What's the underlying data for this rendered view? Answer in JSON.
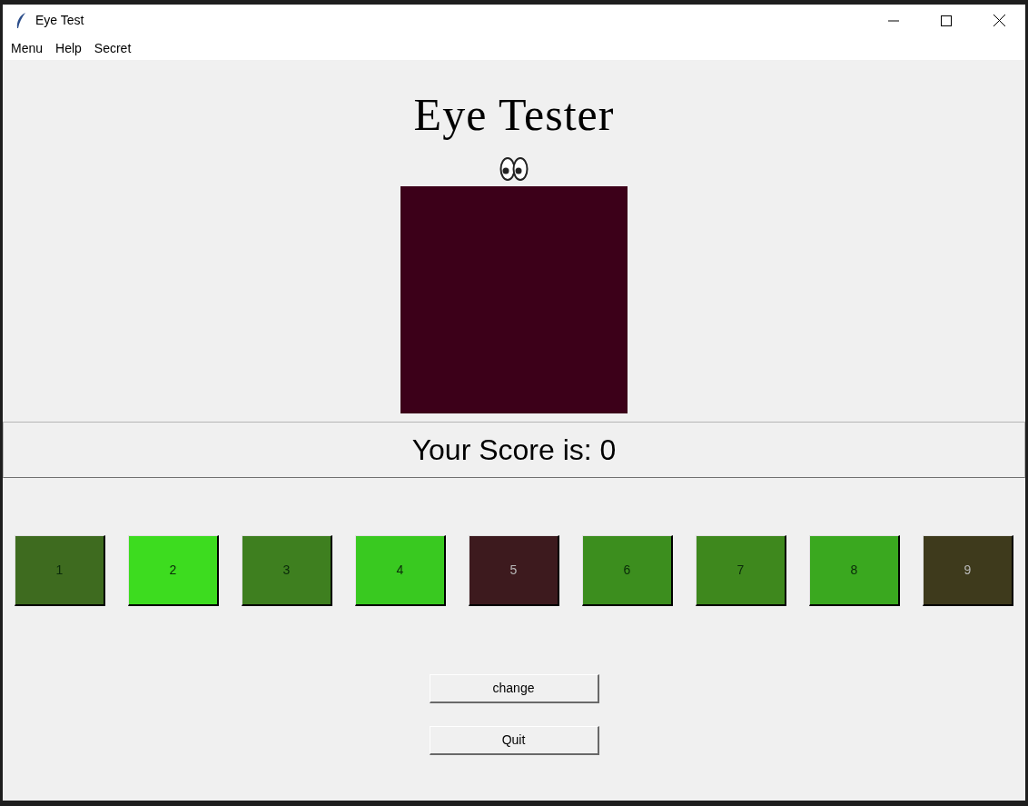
{
  "window": {
    "title": "Eye Test"
  },
  "menu_bar": [
    "Menu",
    "Help",
    "Secret"
  ],
  "heading": "Eye Tester",
  "target": {
    "color": "#3c0019"
  },
  "score": "Your Score is: 0",
  "swatches": [
    {
      "label": "1",
      "color": "#3e6b1f"
    },
    {
      "label": "2",
      "color": "#3ddc1f"
    },
    {
      "label": "3",
      "color": "#3e7f1f"
    },
    {
      "label": "4",
      "color": "#39c920"
    },
    {
      "label": "5",
      "color": "#3d1a1e"
    },
    {
      "label": "6",
      "color": "#3c8e1e"
    },
    {
      "label": "7",
      "color": "#3e881d"
    },
    {
      "label": "8",
      "color": "#3aa81f"
    },
    {
      "label": "9",
      "color": "#3e3a1c"
    }
  ],
  "buttons": [
    "change",
    "Quit"
  ]
}
